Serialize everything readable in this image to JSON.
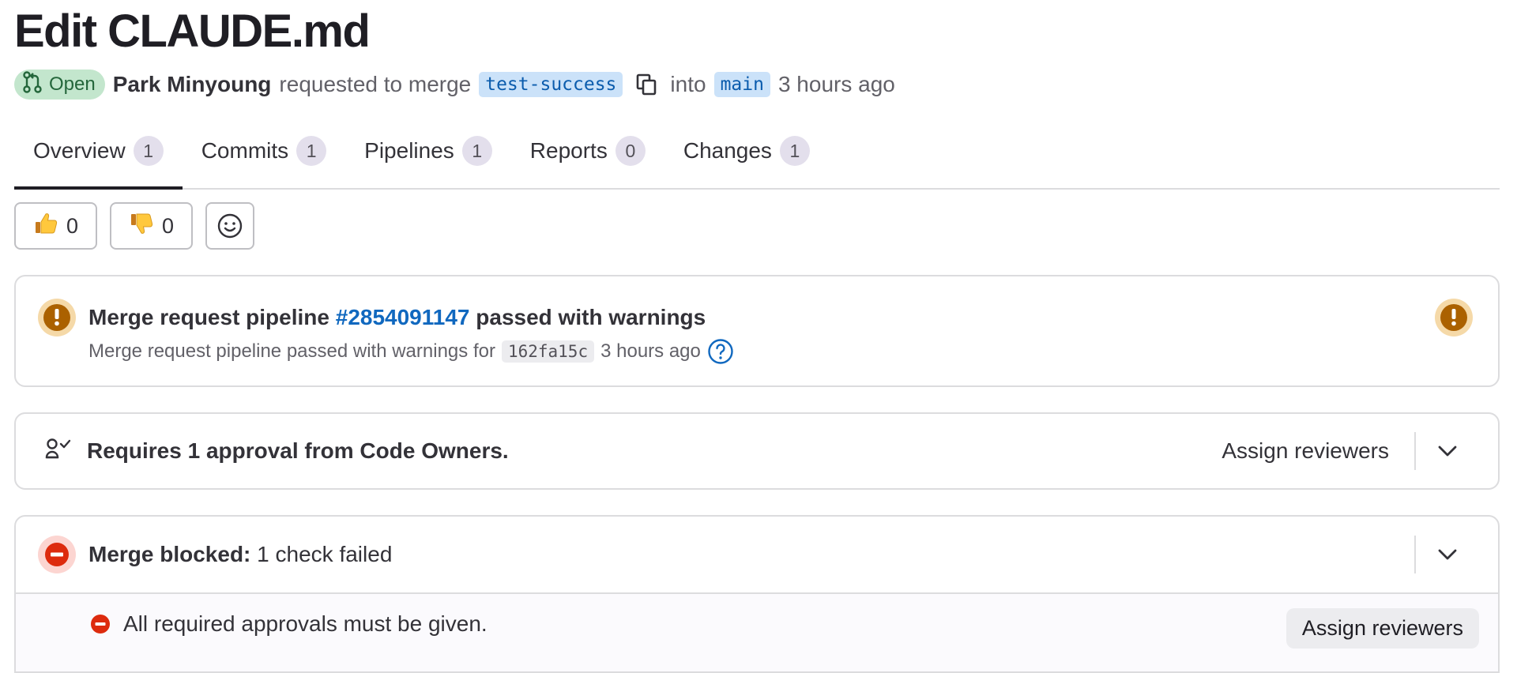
{
  "title": "Edit CLAUDE.md",
  "meta": {
    "status": "Open",
    "author": "Park Minyoung",
    "action": "requested to merge",
    "source_branch": "test-success",
    "into": "into",
    "target_branch": "main",
    "time": "3 hours ago"
  },
  "tabs": [
    {
      "label": "Overview",
      "count": "1"
    },
    {
      "label": "Commits",
      "count": "1"
    },
    {
      "label": "Pipelines",
      "count": "1"
    },
    {
      "label": "Reports",
      "count": "0"
    },
    {
      "label": "Changes",
      "count": "1"
    }
  ],
  "reactions": {
    "thumbs_up": "0",
    "thumbs_down": "0"
  },
  "pipeline": {
    "title_prefix": "Merge request pipeline",
    "id": "#2854091147",
    "title_suffix": "passed with warnings",
    "sub_prefix": "Merge request pipeline passed with warnings for",
    "sha": "162fa15c",
    "time": "3 hours ago"
  },
  "approval": {
    "text": "Requires 1 approval from Code Owners.",
    "assign_label": "Assign reviewers"
  },
  "blocked": {
    "title": "Merge blocked:",
    "detail": "1 check failed",
    "check_text": "All required approvals must be given.",
    "assign_label": "Assign reviewers"
  },
  "colors": {
    "open_badge_bg": "#c3e6cd",
    "branch_bg": "#cbe2f9",
    "link": "#1068bf",
    "warning": "#ab6100",
    "danger": "#dd2b0e"
  }
}
